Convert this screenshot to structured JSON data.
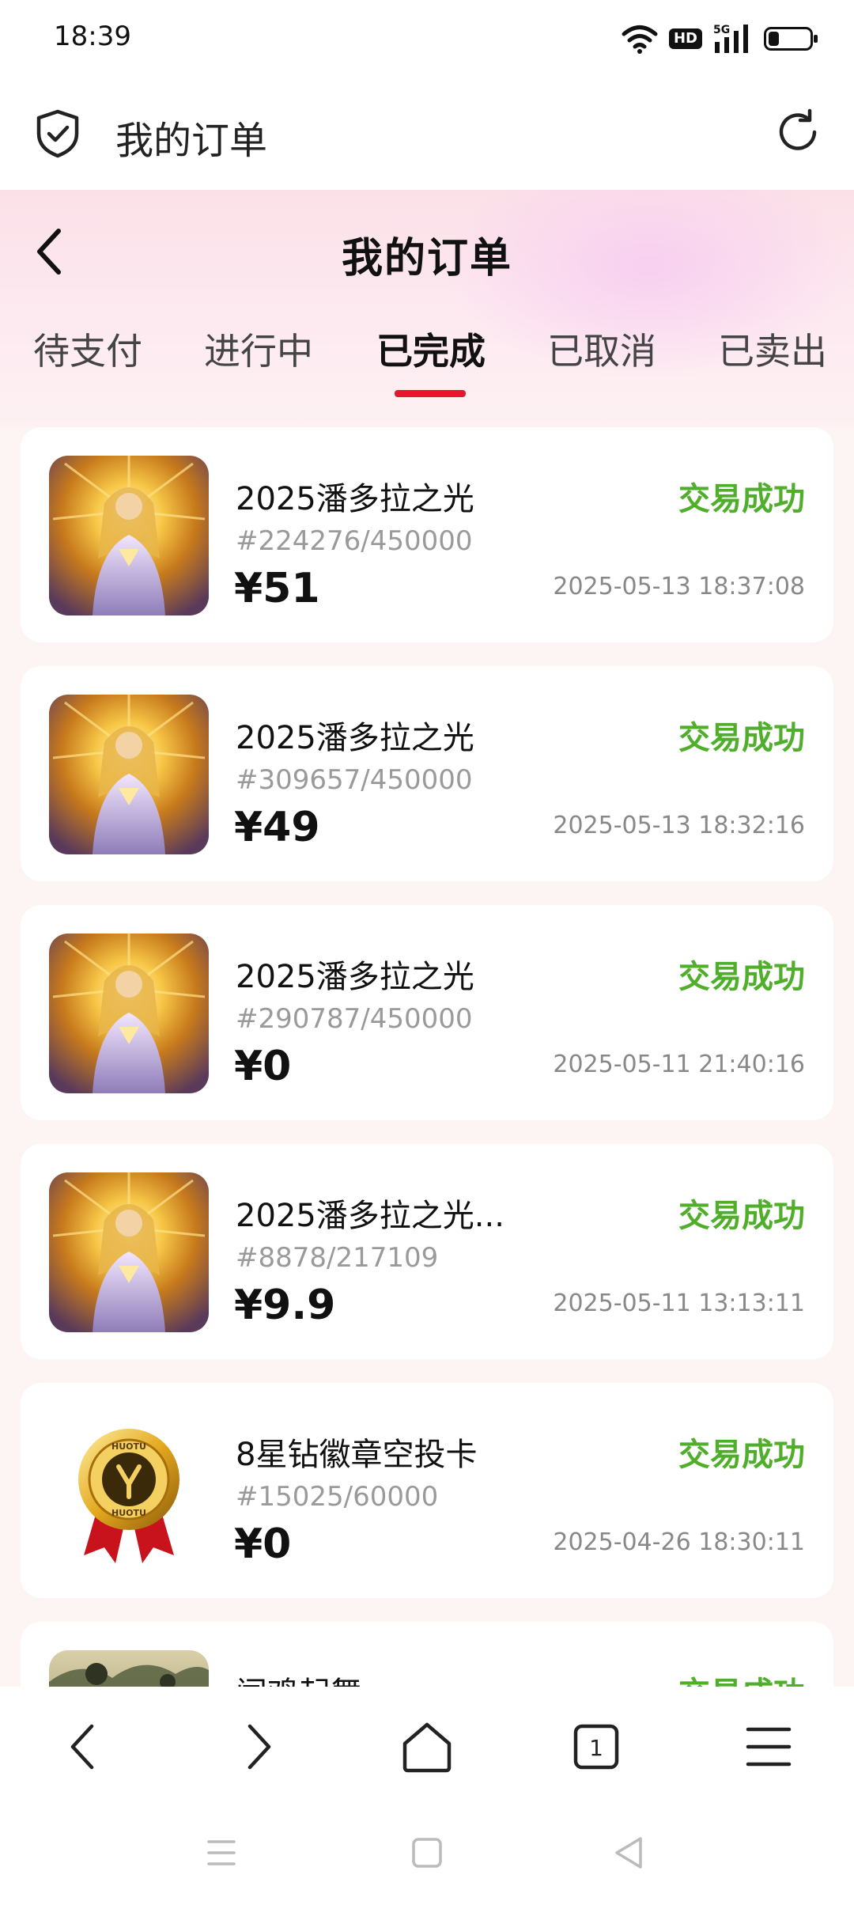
{
  "status_bar": {
    "time": "18:39",
    "hd_label": "HD",
    "network_label": "5G",
    "battery_level": 0.25,
    "icons": [
      "wifi-icon",
      "hd-icon",
      "signal-5g-icon",
      "battery-icon"
    ]
  },
  "browser": {
    "title": "我的订单",
    "icons": [
      "shield-check-icon",
      "refresh-icon"
    ]
  },
  "page": {
    "title": "我的订单",
    "back_icon": "chevron-left-icon"
  },
  "tabs": [
    {
      "label": "待支付",
      "active": false
    },
    {
      "label": "进行中",
      "active": false
    },
    {
      "label": "已完成",
      "active": true
    },
    {
      "label": "已取消",
      "active": false
    },
    {
      "label": "已卖出",
      "active": false
    }
  ],
  "orders": [
    {
      "name": "2025潘多拉之光",
      "serial": "#224276/450000",
      "price": "¥51",
      "status": "交易成功",
      "time": "2025-05-13 18:37:08",
      "thumb": "golden-goddess-artwork"
    },
    {
      "name": "2025潘多拉之光",
      "serial": "#309657/450000",
      "price": "¥49",
      "status": "交易成功",
      "time": "2025-05-13 18:32:16",
      "thumb": "golden-goddess-artwork"
    },
    {
      "name": "2025潘多拉之光",
      "serial": "#290787/450000",
      "price": "¥0",
      "status": "交易成功",
      "time": "2025-05-11 21:40:16",
      "thumb": "golden-goddess-artwork"
    },
    {
      "name": "2025潘多拉之光...",
      "serial": "#8878/217109",
      "price": "¥9.9",
      "status": "交易成功",
      "time": "2025-05-11 13:13:11",
      "thumb": "golden-goddess-artwork"
    },
    {
      "name": "8星钻徽章空投卡",
      "serial": "#15025/60000",
      "price": "¥0",
      "status": "交易成功",
      "time": "2025-04-26 18:30:11",
      "thumb": "gold-medal-badge"
    },
    {
      "name": "闻鸡起舞",
      "serial": "",
      "price": "",
      "status": "交易成功",
      "time": "",
      "thumb": "landscape-painting"
    }
  ],
  "medal_text": "HUOTU",
  "bottom_nav": {
    "tab_count": "1",
    "icons": [
      "back-arrow-icon",
      "forward-arrow-icon",
      "home-icon",
      "tabs-icon",
      "menu-icon"
    ]
  },
  "system_nav": {
    "icons": [
      "recents-icon",
      "home-square-icon",
      "back-triangle-icon"
    ]
  },
  "colors": {
    "accent_red": "#e6162d",
    "status_green": "#4fae2a",
    "page_bg": "#fdf4f4"
  }
}
